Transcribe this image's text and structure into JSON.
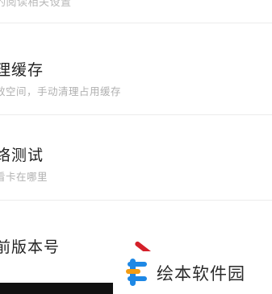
{
  "settings": {
    "top_item_desc": "的阅读相关设置",
    "items": [
      {
        "title": "理缓存",
        "subtitle": "效空间，手动清理占用缓存"
      },
      {
        "title": "络测试",
        "subtitle": "看卡在哪里"
      },
      {
        "title": "前版本号",
        "subtitle": ""
      }
    ]
  },
  "watermark": {
    "text": "绘本软件园",
    "colors": {
      "blue": "#1e88e5",
      "orange": "#f39c12"
    }
  },
  "colors": {
    "title": "#222222",
    "subtitle": "#b0b0b0",
    "divider": "#ececec",
    "accent_red": "#d4202a"
  }
}
